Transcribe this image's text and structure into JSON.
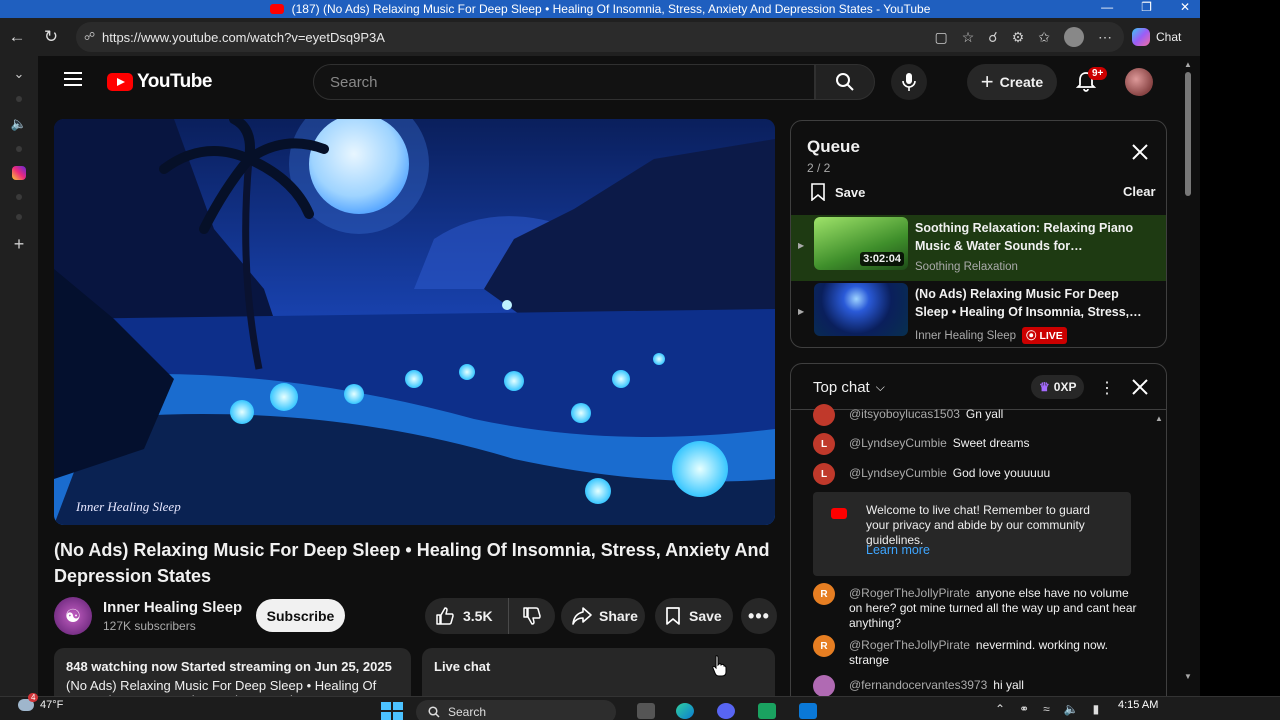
{
  "window": {
    "title": "(187) (No Ads) Relaxing Music For Deep Sleep • Healing Of Insomnia, Stress, Anxiety And Depression States - YouTube"
  },
  "browser": {
    "url": "https://www.youtube.com/watch?v=eyetDsq9P3A",
    "chat_label": "Chat"
  },
  "youtube": {
    "logo_text": "YouTube",
    "search_placeholder": "Search",
    "create_label": "Create",
    "notifications_badge": "9+"
  },
  "video": {
    "title": "(No Ads) Relaxing Music For Deep Sleep • Healing Of Insomnia, Stress, Anxiety And Depression States",
    "watermark": "Inner Healing Sleep",
    "channel_name": "Inner Healing Sleep",
    "subscribers": "127K subscribers",
    "subscribe_label": "Subscribe",
    "likes": "3.5K",
    "share_label": "Share",
    "save_label": "Save",
    "description_meta": "848 watching now  Started streaming on Jun 25, 2025",
    "description_line": "(No Ads) Relaxing Music For Deep Sleep • Healing Of Insomnia, Stress, Anxiety And Depression States",
    "live_chat_label": "Live chat"
  },
  "queue": {
    "title": "Queue",
    "count": "2 / 2",
    "save_label": "Save",
    "clear_label": "Clear",
    "items": [
      {
        "title": "Soothing Relaxation: Relaxing Piano Music & Water Sounds for…",
        "channel": "Soothing Relaxation",
        "duration": "3:02:04"
      },
      {
        "title": "(No Ads) Relaxing Music For Deep Sleep • Healing Of Insomnia, Stress,…",
        "channel": "Inner Healing Sleep",
        "badge": "LIVE"
      }
    ]
  },
  "chat": {
    "mode_label": "Top chat",
    "xp_label": "0XP",
    "messages": [
      {
        "author": "@itsyoboylucas1503",
        "text": "Gn yall",
        "initial": "",
        "color": "#c0392b"
      },
      {
        "author": "@LyndseyCumbie",
        "text": "Sweet dreams",
        "initial": "L",
        "color": "#c0392b"
      },
      {
        "author": "@LyndseyCumbie",
        "text": "God love youuuuu",
        "initial": "L",
        "color": "#c0392b"
      },
      {
        "author": "@RogerTheJollyPirate",
        "text": "anyone else have no volume on here? got mine turned all the way up and cant hear anything?",
        "initial": "R",
        "color": "#e67e22"
      },
      {
        "author": "@RogerTheJollyPirate",
        "text": "nevermind. working now. strange",
        "initial": "R",
        "color": "#e67e22"
      },
      {
        "author": "@fernandocervantes3973",
        "text": "hi yall",
        "initial": "",
        "color": "#b06ab3"
      }
    ],
    "welcome_text": "Welcome to live chat! Remember to guard your privacy and abide by our community guidelines.",
    "learn_more": "Learn more"
  },
  "taskbar": {
    "weather_temp": "47°F",
    "weather_badge": "4",
    "search_label": "Search",
    "time": "4:15 AM"
  }
}
